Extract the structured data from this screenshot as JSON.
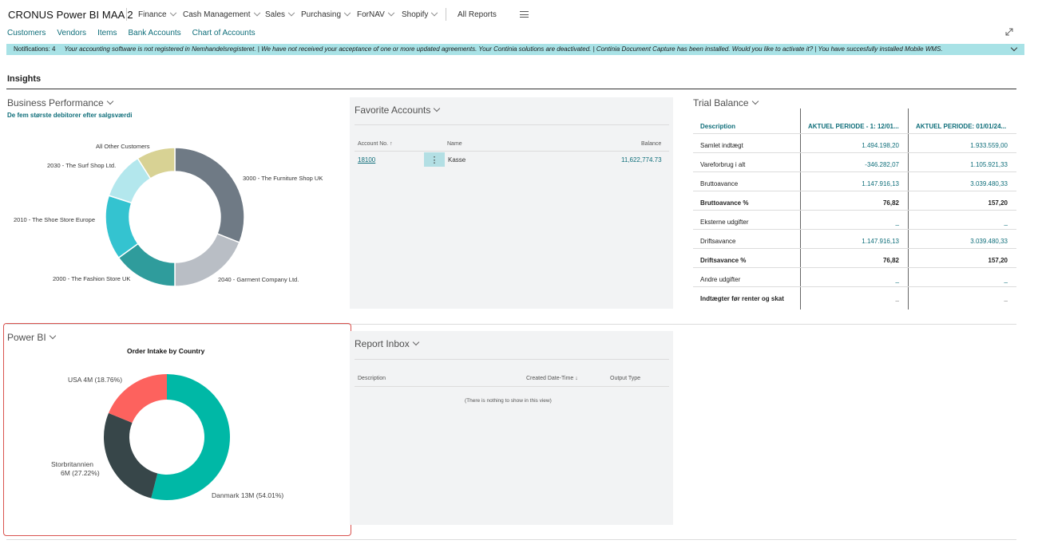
{
  "app": {
    "title": "CRONUS Power BI MAA 2"
  },
  "menu": [
    {
      "label": "Finance"
    },
    {
      "label": "Cash Management"
    },
    {
      "label": "Sales"
    },
    {
      "label": "Purchasing"
    },
    {
      "label": "ForNAV"
    },
    {
      "label": "Shopify"
    }
  ],
  "all_reports": "All Reports",
  "links": [
    "Customers",
    "Vendors",
    "Items",
    "Bank Accounts",
    "Chart of Accounts"
  ],
  "notifications": {
    "count_label": "Notifications: 4",
    "text": "Your accounting software is not registered in Nemhandelsregisteret.  |  We have not received your acceptance of one or more updated agreements. Your Continia solutions are deactivated.  |  Continia Document Capture has been installed. Would you like to activate it?  |  You have succesfully installed Mobile WMS."
  },
  "insights": "Insights",
  "business_performance": {
    "title": "Business Performance",
    "subtitle": "De fem største debitorer efter salgsværdi",
    "chart_data": {
      "type": "pie",
      "categories": [
        "3000 - The Furniture Shop UK",
        "2040 - Garment Company Ltd.",
        "2000 - The Fashion Store UK",
        "2010 - The Shoe Store Europe",
        "2030 - The Surf Shop Ltd.",
        "All Other Customers"
      ],
      "values": [
        31,
        19,
        15,
        15,
        11,
        9
      ],
      "colors": [
        "#6f7a85",
        "#b9bec5",
        "#2f9c9c",
        "#34c3d0",
        "#b3e7ed",
        "#d8d294"
      ]
    }
  },
  "favorite_accounts": {
    "title": "Favorite Accounts",
    "headers": {
      "account_no": "Account No. ↑",
      "name": "Name",
      "balance": "Balance"
    },
    "rows": [
      {
        "account_no": "18100",
        "name": "Kasse",
        "balance": "11,622,774.73"
      }
    ]
  },
  "trial_balance": {
    "title": "Trial Balance",
    "headers": [
      "Description",
      "AKTUEL PERIODE - 1: 12/01...",
      "AKTUEL PERIODE: 01/01/24..."
    ],
    "rows": [
      {
        "desc": "Samlet indtægt",
        "v1": "1.494.198,20",
        "v2": "1.933.559,00",
        "bold": false
      },
      {
        "desc": "Vareforbrug i alt",
        "v1": "-346.282,07",
        "v2": "1.105.921,33",
        "bold": false
      },
      {
        "desc": "Bruttoavance",
        "v1": "1.147.916,13",
        "v2": "3.039.480,33",
        "bold": false
      },
      {
        "desc": "Bruttoavance %",
        "v1": "76,82",
        "v2": "157,20",
        "bold": true
      },
      {
        "desc": "Eksterne udgifter",
        "v1": "_",
        "v2": "_",
        "bold": false
      },
      {
        "desc": "Driftsavance",
        "v1": "1.147.916,13",
        "v2": "3.039.480,33",
        "bold": false
      },
      {
        "desc": "Driftsavance %",
        "v1": "76,82",
        "v2": "157,20",
        "bold": true
      },
      {
        "desc": "Andre udgifter",
        "v1": "_",
        "v2": "_",
        "bold": false
      },
      {
        "desc": "Indtægter før renter og skat",
        "v1": "_",
        "v2": "_",
        "bold": true
      }
    ]
  },
  "power_bi": {
    "title": "Power BI",
    "chart_title": "Order Intake by Country",
    "labels": {
      "usa": "USA 4M (18.76%)",
      "uk_1": "Storbritannien",
      "uk_2": "6M (27.22%)",
      "dk": "Danmark 13M (54.01%)"
    },
    "chart_data": {
      "type": "pie",
      "categories": [
        "Danmark",
        "Storbritannien",
        "USA"
      ],
      "values": [
        54.01,
        27.22,
        18.76
      ],
      "colors": [
        "#00b8a6",
        "#374649",
        "#fd625e"
      ]
    }
  },
  "report_inbox": {
    "title": "Report Inbox",
    "headers": {
      "description": "Description",
      "created": "Created Date-Time ↓",
      "output_type": "Output Type"
    },
    "empty": "(There is nothing to show in this view)"
  }
}
